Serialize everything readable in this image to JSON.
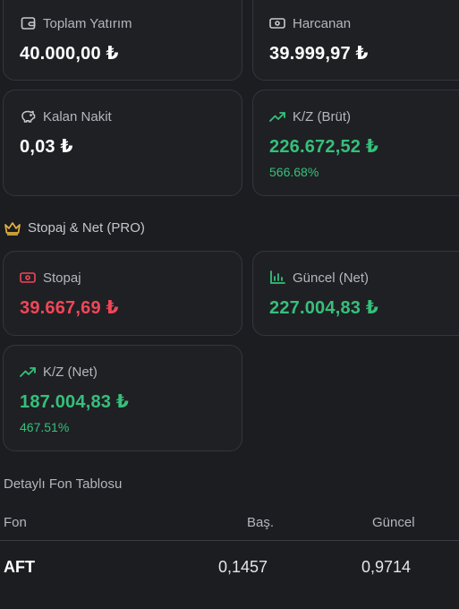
{
  "colors": {
    "background": "#1c1d21",
    "card_border": "#34363c",
    "green": "#35c07a",
    "red": "#f04658",
    "gold": "#e3b13c",
    "label": "#b4b6bc"
  },
  "cards": {
    "toplam_yatirim": {
      "label": "Toplam Yatırım",
      "value": "40.000,00 ₺",
      "icon": "wallet-icon"
    },
    "harcanan": {
      "label": "Harcanan",
      "value": "39.999,97 ₺",
      "icon": "banknote-icon"
    },
    "kalan_nakit": {
      "label": "Kalan Nakit",
      "value": "0,03 ₺",
      "icon": "piggy-bank-icon"
    },
    "kz_brut": {
      "label": "K/Z (Brüt)",
      "value": "226.672,52 ₺",
      "percent": "566.68%",
      "icon": "trending-up-icon"
    }
  },
  "section": {
    "title": "Stopaj & Net (PRO)",
    "icon": "crown-icon"
  },
  "pro_cards": {
    "stopaj": {
      "label": "Stopaj",
      "value": "39.667,69 ₺",
      "icon": "banknote-icon"
    },
    "guncel_net": {
      "label": "Güncel (Net)",
      "value": "227.004,83 ₺",
      "icon": "bar-chart-icon"
    },
    "kz_net": {
      "label": "K/Z (Net)",
      "value": "187.004,83 ₺",
      "percent": "467.51%",
      "icon": "trending-up-icon"
    }
  },
  "table": {
    "title": "Detaylı Fon Tablosu",
    "headers": [
      "Fon",
      "Baş.",
      "Güncel"
    ],
    "rows": [
      {
        "fon": "AFT",
        "bas": "0,1457",
        "guncel": "0,9714"
      }
    ]
  }
}
